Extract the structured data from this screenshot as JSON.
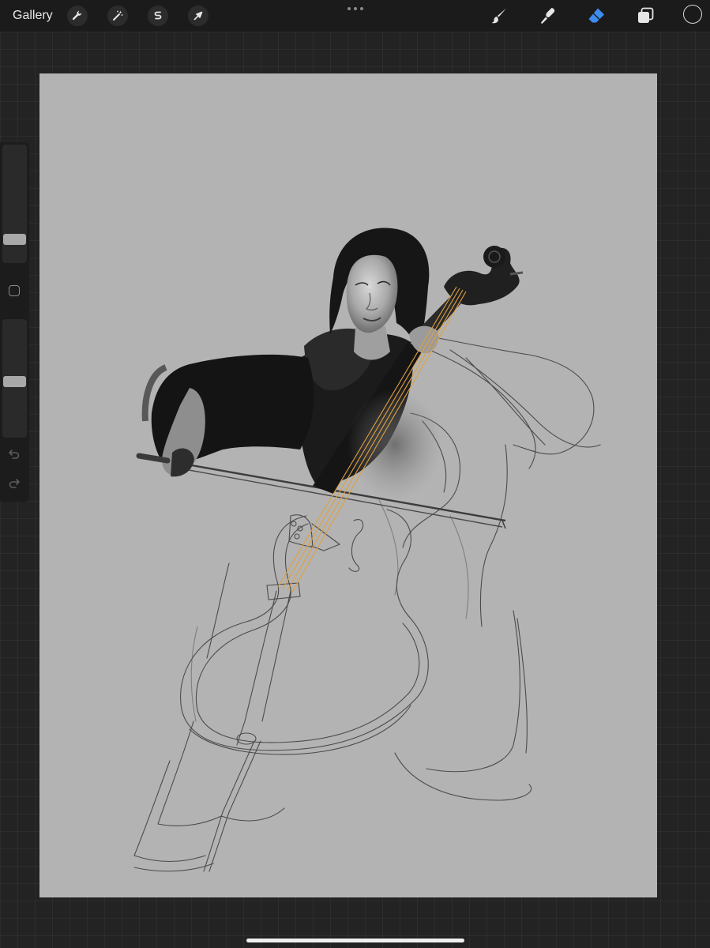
{
  "toolbar": {
    "gallery_label": "Gallery",
    "left_tools": [
      {
        "icon": "wrench-icon",
        "name": "actions"
      },
      {
        "icon": "magic-wand-icon",
        "name": "adjustments"
      },
      {
        "icon": "selection-s-icon",
        "name": "selection"
      },
      {
        "icon": "arrow-cursor-icon",
        "name": "transform"
      }
    ],
    "right_tools": [
      {
        "icon": "brush-icon",
        "name": "paint",
        "active": false
      },
      {
        "icon": "smudge-icon",
        "name": "smudge",
        "active": false
      },
      {
        "icon": "eraser-icon",
        "name": "erase",
        "active": true
      },
      {
        "icon": "layers-icon",
        "name": "layers",
        "active": false
      }
    ],
    "active_color": "#1a1a1a",
    "active_tool_color": "#3d8cf0"
  },
  "sidebar": {
    "brush_size_level": 0.17,
    "opacity_level": 0.47,
    "modify_icon": "square-outline-icon",
    "undo_icon": "undo-arrow-icon",
    "redo_icon": "redo-arrow-icon"
  },
  "canvas": {
    "background_color": "#b3b3b3"
  }
}
